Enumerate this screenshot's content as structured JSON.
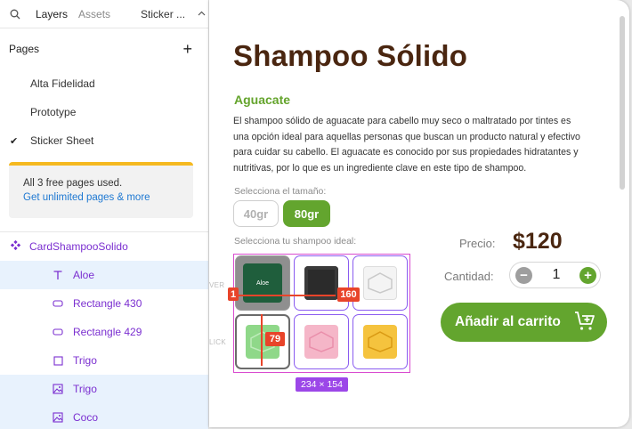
{
  "topbar": {
    "layers_tab": "Layers",
    "assets_tab": "Assets",
    "sticker_tab": "Sticker ..."
  },
  "pages": {
    "heading": "Pages",
    "items": [
      "Alta Fidelidad",
      "Prototype",
      "Sticker Sheet"
    ],
    "active_index": 2
  },
  "notice": {
    "line1": "All 3 free pages used.",
    "line2": "Get unlimited pages & more"
  },
  "layers": {
    "component": "CardShampooSolido",
    "children": [
      {
        "label": "Aloe",
        "icon": "text-icon",
        "selected": true
      },
      {
        "label": "Rectangle 430",
        "icon": "rectangle-icon",
        "selected": false
      },
      {
        "label": "Rectangle 429",
        "icon": "rectangle-icon",
        "selected": false
      },
      {
        "label": "Trigo",
        "icon": "frame-icon",
        "selected": false
      },
      {
        "label": "Trigo",
        "icon": "image-icon",
        "selected": true
      },
      {
        "label": "Coco",
        "icon": "image-icon",
        "selected": true
      }
    ]
  },
  "card": {
    "title": "Shampoo Sólido",
    "subtitle": "Aguacate",
    "description": [
      "El shampoo sólido de aguacate para cabello muy seco o maltratado por tintes es",
      "una opción ideal para aquellas personas que buscan un producto natural y efectivo",
      "para cuidar su cabello. El aguacate es conocido por sus propiedades hidratantes y",
      "nutritivas, por lo que es un ingrediente clave en este tipo de shampoo."
    ],
    "size_label": "Selecciona el tamaño:",
    "size_options": [
      "40gr",
      "80gr"
    ],
    "selected_size": "80gr",
    "shampoo_label": "Selecciona tu shampoo ideal:",
    "first_cell_label": "Aloe",
    "price_label": "Precio:",
    "price": "$120",
    "qty_label": "Cantidad:",
    "qty_value": "1",
    "qty_minus": "−",
    "qty_plus": "+",
    "cart_button": "Añadir al carrito"
  },
  "overlay": {
    "dim_badge": "234 × 154",
    "measure_left": "1",
    "measure_right": "160",
    "measure_bottom": "79",
    "ghost_over": "VER",
    "ghost_click": "LICK"
  },
  "colors": {
    "brand_brown": "#4a2610",
    "brand_green": "#63a52e",
    "selection_purple": "#9c47e8",
    "measure_red": "#e8442a",
    "notice_yellow": "#f5b920"
  }
}
